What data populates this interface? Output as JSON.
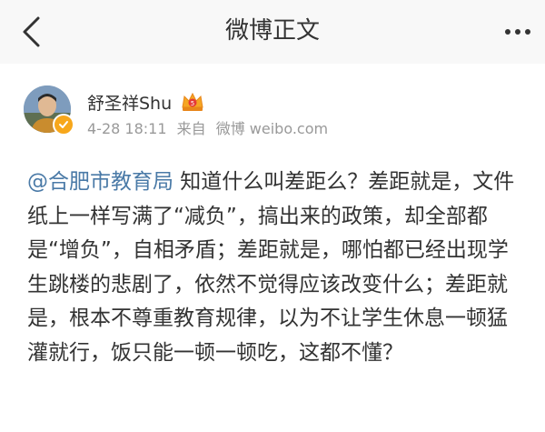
{
  "nav": {
    "title": "微博正文",
    "back_icon": "chevron-left-icon",
    "more_icon": "more-dots-icon"
  },
  "post": {
    "author": "舒圣祥Shu",
    "verified_color": "#f7a71b",
    "vip_color": "#f5a623",
    "time": "4-28 18:11",
    "source_prefix": "来自",
    "source": "微博 weibo.com",
    "mention": "@合肥市教育局",
    "text": " 知道什么叫差距么？差距就是，文件纸上一样写满了“减负”，搞出来的政策，却全部都是“增负”，自相矛盾；差距就是，哪怕都已经出现学生跳楼的悲剧了，依然不觉得应该改变什么；差距就是，根本不尊重教育规律，以为不让学生休息一顿猛灌就行，饭只能一顿一顿吃，这都不懂？"
  },
  "colors": {
    "link": "#4a7aa7",
    "meta": "#999999",
    "text": "#333333"
  }
}
